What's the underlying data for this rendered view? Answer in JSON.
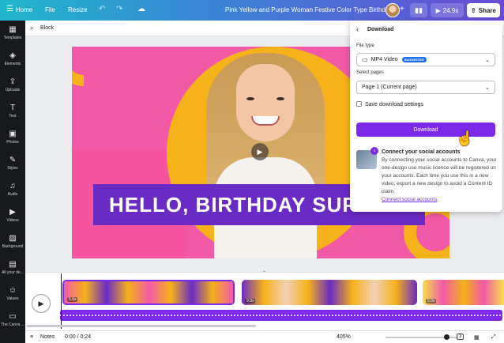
{
  "topbar": {
    "home": "Home",
    "file": "File",
    "resize": "Resize",
    "doc_title": "Pink Yellow and Purple Woman Festive Color Type Birthday ...",
    "play_duration": "24.9s",
    "share": "Share"
  },
  "sidebar": {
    "items": [
      {
        "label": "Templates",
        "icon": "templates-icon",
        "glyph": "▦"
      },
      {
        "label": "Elements",
        "icon": "elements-icon",
        "glyph": "◈"
      },
      {
        "label": "Uploads",
        "icon": "uploads-icon",
        "glyph": "⇪"
      },
      {
        "label": "Text",
        "icon": "text-icon",
        "glyph": "T"
      },
      {
        "label": "Photos",
        "icon": "photos-icon",
        "glyph": "▣"
      },
      {
        "label": "Styles",
        "icon": "styles-icon",
        "glyph": "✎"
      },
      {
        "label": "Audio",
        "icon": "audio-icon",
        "glyph": "♫"
      },
      {
        "label": "Videos",
        "icon": "videos-icon",
        "glyph": "▶"
      },
      {
        "label": "Background",
        "icon": "background-icon",
        "glyph": "▨"
      },
      {
        "label": "All your de...",
        "icon": "all-designs-icon",
        "glyph": "▤"
      },
      {
        "label": "Values",
        "icon": "values-icon",
        "glyph": "☺"
      },
      {
        "label": "The Canva ...",
        "icon": "folder-icon",
        "glyph": "▭"
      }
    ]
  },
  "toolbar": {
    "block_label": "Block"
  },
  "design": {
    "headline": "HELLO, BIRTHDAY SUPER"
  },
  "download_panel": {
    "title": "Download",
    "file_type_label": "File type",
    "file_type_value": "MP4 Video",
    "suggested_badge": "SUGGESTED",
    "select_pages_label": "Select pages",
    "select_pages_value": "Page 1 (Current page)",
    "save_settings_label": "Save download settings",
    "download_button": "Download",
    "social_title": "Connect your social accounts",
    "social_body": "By connecting your social accounts to Canva, your one-design use music licence will be registered on your accounts. Each time you use this in a new video, export a new design to avoid a Content ID claim.",
    "social_link": "Connect social accounts"
  },
  "timeline": {
    "clips": [
      {
        "duration": "5.0s"
      },
      {
        "duration": "9.9s"
      },
      {
        "duration": "5.0s"
      }
    ]
  },
  "bottombar": {
    "notes": "Notes",
    "time": "0:00 / 0:24",
    "zoom": "405%",
    "page_count": "3"
  },
  "colors": {
    "accent": "#7d2ae8",
    "design_pink": "#f25aa8",
    "design_yellow": "#f5b219",
    "banner_purple": "#6a2bc4"
  }
}
